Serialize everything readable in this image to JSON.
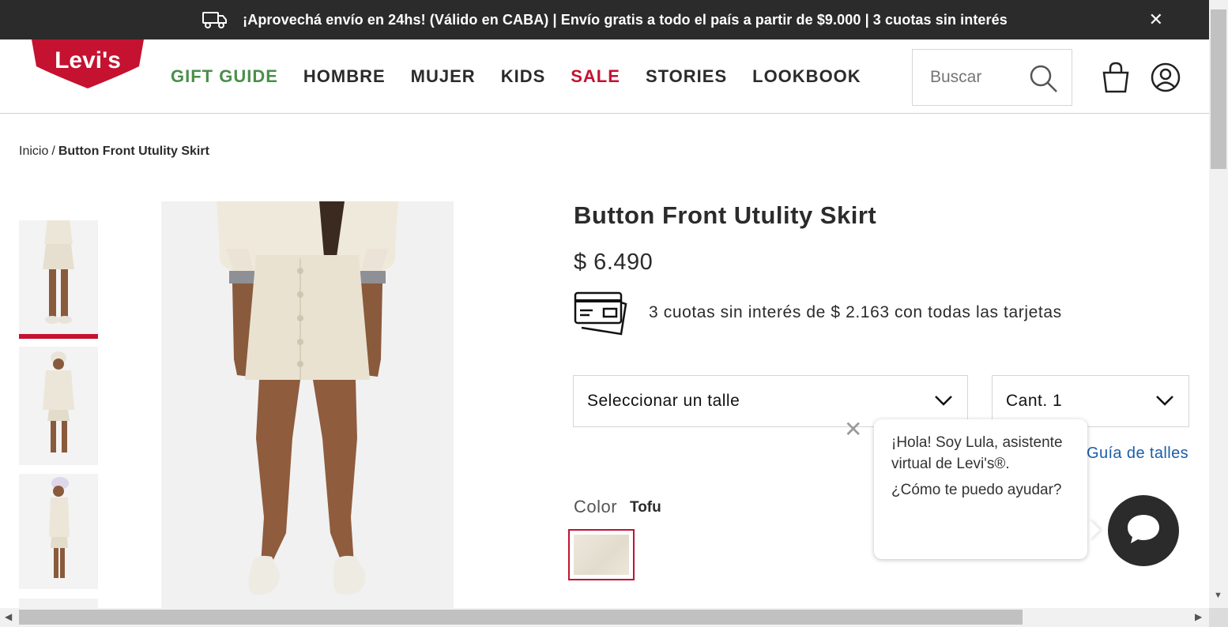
{
  "promo": {
    "text": "¡Aprovechá envío en 24hs! (Válido en CABA) | Envío gratis a todo el país a partir de $9.000 | 3 cuotas sin interés",
    "close": "✕",
    "icon": "truck-icon"
  },
  "header": {
    "logo_text": "Levi's",
    "logo_mark": "®",
    "nav": [
      "GIFT GUIDE",
      "HOMBRE",
      "MUJER",
      "KIDS",
      "SALE",
      "STORIES",
      "LOOKBOOK"
    ],
    "search_placeholder": "Buscar",
    "icons": [
      "search-icon",
      "bag-icon",
      "user-icon"
    ]
  },
  "breadcrumb": {
    "home": "Inicio",
    "separator": "/",
    "current": "Button Front Utulity Skirt"
  },
  "product": {
    "title": "Button Front Utulity Skirt",
    "price": "$ 6.490",
    "installments": "3 cuotas sin interés de $ 2.163 con todas las tarjetas",
    "size_select": "Seleccionar un talle",
    "qty_select": "Cant. 1",
    "size_guide": "Guía de talles",
    "color_label": "Color",
    "color_value": "Tofu"
  },
  "chat": {
    "close": "✕",
    "greeting": "¡Hola! Soy Lula, asistente virtual de Levi's®.",
    "question": "¿Cómo te puedo ayudar?"
  },
  "colors": {
    "accent": "#c41230",
    "gift": "#4a8f4a",
    "link": "#1a5ea8",
    "dark": "#2b2b2b"
  }
}
